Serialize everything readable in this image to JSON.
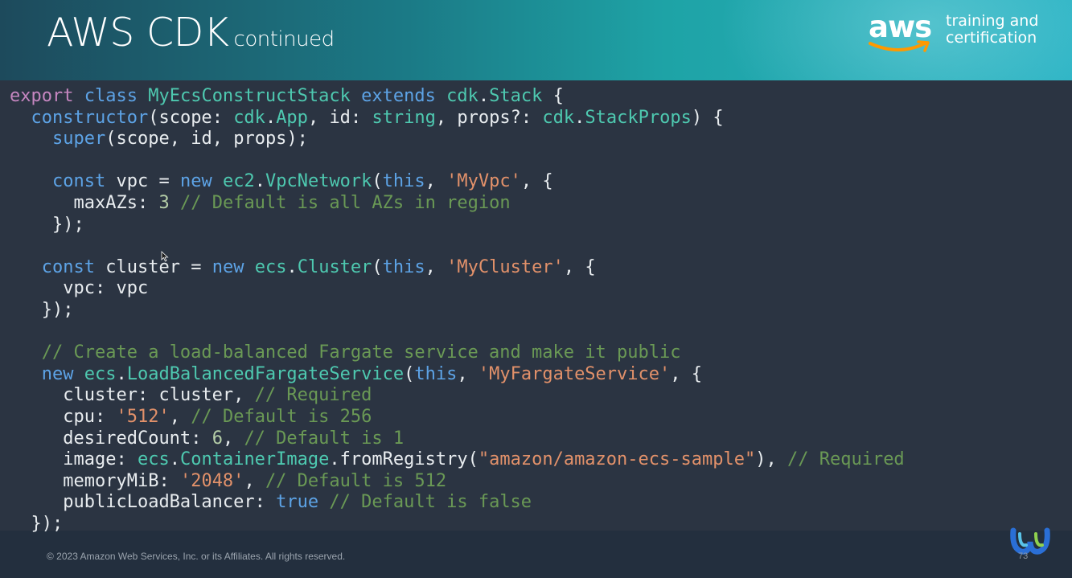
{
  "header": {
    "title": "AWS CDK",
    "subtitle": "continued",
    "logo": {
      "word": "aws",
      "line1": "training and",
      "line2": "certification"
    }
  },
  "code": {
    "lines": [
      "export class MyEcsConstructStack extends cdk.Stack {",
      "  constructor(scope: cdk.App, id: string, props?: cdk.StackProps) {",
      "    super(scope, id, props);",
      "",
      "    const vpc = new ec2.VpcNetwork(this, 'MyVpc', {",
      "      maxAZs: 3 // Default is all AZs in region",
      "    });",
      "",
      "   const cluster = new ecs.Cluster(this, 'MyCluster', {",
      "     vpc: vpc",
      "   });",
      "",
      "   // Create a load-balanced Fargate service and make it public",
      "   new ecs.LoadBalancedFargateService(this, 'MyFargateService', {",
      "     cluster: cluster, // Required",
      "     cpu: '512', // Default is 256",
      "     desiredCount: 6, // Default is 1",
      "     image: ecs.ContainerImage.fromRegistry(\"amazon/amazon-ecs-sample\"), // Required",
      "     memoryMiB: '2048', // Default is 512",
      "     publicLoadBalancer: true // Default is false",
      "  });"
    ]
  },
  "footer": {
    "copyright": "© 2023 Amazon Web Services, Inc. or its Affiliates. All rights reserved.",
    "page_number": "73"
  },
  "colors": {
    "header_start": "#1d4a5c",
    "header_end": "#2ab3c4",
    "code_bg": "#2b3442",
    "keyword": "#c586c0",
    "storage": "#5da3e6",
    "class": "#4ec9b0",
    "string": "#e2916a",
    "comment": "#6a9955",
    "aws_orange": "#ff9900"
  },
  "icons": [
    "mouse-cursor-icon",
    "corner-logo-icon"
  ]
}
